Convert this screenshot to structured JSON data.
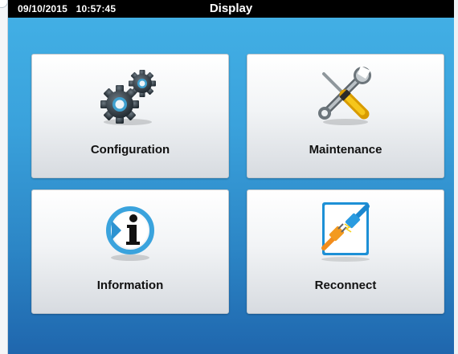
{
  "header": {
    "date": "09/10/2015",
    "time": "10:57:45",
    "title": "Display"
  },
  "tiles": [
    {
      "label": "Configuration",
      "icon": "gears-icon"
    },
    {
      "label": "Maintenance",
      "icon": "wrench-screwdriver-icon"
    },
    {
      "label": "Information",
      "icon": "info-icon"
    },
    {
      "label": "Reconnect",
      "icon": "plug-connect-icon"
    }
  ],
  "colors": {
    "background_top": "#43b1e6",
    "background_bottom": "#1f66ad",
    "titlebar": "#000000",
    "tile_top": "#ffffff",
    "tile_bottom": "#d7dbe0"
  }
}
